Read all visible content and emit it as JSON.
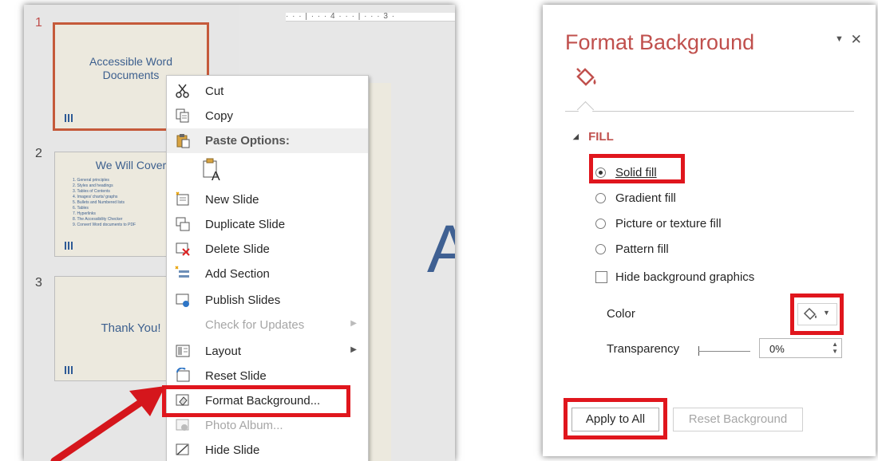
{
  "left": {
    "ruler_text": "· · · | · · · 4 · · · | · · · 3 ·",
    "big_letter": "A",
    "slides": [
      {
        "number": "1",
        "title": "Accessible Word Documents"
      },
      {
        "number": "2",
        "title": "We Will Cover",
        "bullets": [
          "1. General principles",
          "2. Styles and headings",
          "3. Tables of Contents",
          "4. Images/ charts/ graphs",
          "5. Bullets and Numbered lists",
          "6. Tables",
          "7. Hyperlinks",
          "8. The Accessibility Checker",
          "9. Convert Word documents to PDF"
        ]
      },
      {
        "number": "3",
        "title": "Thank You!"
      }
    ]
  },
  "context_menu": {
    "items": [
      {
        "label": "Cut",
        "icon": "scissors-icon",
        "state": "enabled"
      },
      {
        "label": "Copy",
        "icon": "copy-icon",
        "state": "enabled"
      },
      {
        "label": "Paste Options:",
        "icon": "paste-icon",
        "state": "header"
      },
      {
        "label": "New Slide",
        "icon": "new-slide-icon",
        "state": "enabled"
      },
      {
        "label": "Duplicate Slide",
        "icon": "duplicate-slide-icon",
        "state": "enabled"
      },
      {
        "label": "Delete Slide",
        "icon": "delete-slide-icon",
        "state": "enabled"
      },
      {
        "label": "Add Section",
        "icon": "add-section-icon",
        "state": "enabled"
      },
      {
        "label": "Publish Slides",
        "icon": "publish-slides-icon",
        "state": "enabled"
      },
      {
        "label": "Check for Updates",
        "icon": "",
        "state": "disabled"
      },
      {
        "label": "Layout",
        "icon": "layout-icon",
        "state": "enabled"
      },
      {
        "label": "Reset Slide",
        "icon": "reset-slide-icon",
        "state": "enabled"
      },
      {
        "label": "Format Background...",
        "icon": "format-background-icon",
        "state": "highlighted"
      },
      {
        "label": "Photo Album...",
        "icon": "photo-album-icon",
        "state": "disabled"
      },
      {
        "label": "Hide Slide",
        "icon": "hide-slide-icon",
        "state": "enabled"
      }
    ]
  },
  "format_pane": {
    "title": "Format Background",
    "section": "FILL",
    "fill_options": [
      "Solid fill",
      "Gradient fill",
      "Picture or texture fill",
      "Pattern fill"
    ],
    "selected_fill": "Solid fill",
    "hide_graphics_label": "Hide background graphics",
    "hide_graphics_checked": false,
    "color_label": "Color",
    "transparency_label": "Transparency",
    "transparency_value": "0%",
    "apply_all_label": "Apply to All",
    "reset_label": "Reset Background"
  },
  "colors": {
    "accent": "#c0504d",
    "highlight_box": "#e0161d",
    "slide_bg": "#ece9de",
    "slide_text": "#3c5f8e"
  }
}
